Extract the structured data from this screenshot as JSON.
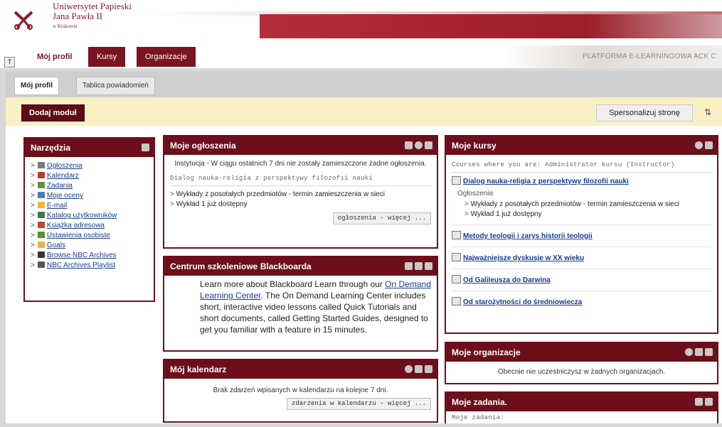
{
  "header": {
    "university_lines": [
      "Uniwersytet Papieski",
      "Jana Pawła II",
      "w Krakowie"
    ],
    "platform_text": "PLATFORMA E-LEARNINGOWA ACK C",
    "colors": {
      "maroon": "#6d0f1b",
      "accent_red": "#a8232f",
      "banner_yellow": "#fbefc4"
    }
  },
  "tabs": [
    {
      "label": "Mój profil"
    },
    {
      "label": "Kursy"
    },
    {
      "label": "Organizacje"
    }
  ],
  "subtabs": [
    {
      "label": "Mój profil"
    },
    {
      "label": "Tablica powiadomień"
    }
  ],
  "toolbar": {
    "add_module": "Dodaj moduł",
    "personalize": "Spersonalizuj stronę",
    "sort_icon": "⇅"
  },
  "tools_module": {
    "title": "Narzędzia",
    "items": [
      {
        "label": "Ogłoszenia",
        "icon": "megaphone-icon",
        "color": "#7a7a7a"
      },
      {
        "label": "Kalendarz",
        "icon": "calendar-icon",
        "color": "#c0392b"
      },
      {
        "label": "Zadania",
        "icon": "tasks-icon",
        "color": "#6a8e3a"
      },
      {
        "label": "Moje oceny",
        "icon": "grades-icon",
        "color": "#4d7fb8"
      },
      {
        "label": "E-mail",
        "icon": "envelope-icon",
        "color": "#e5b93a"
      },
      {
        "label": "Katalog użytkowników",
        "icon": "users-catalog-icon",
        "color": "#3c7a4a"
      },
      {
        "label": "Książka adresowa",
        "icon": "address-book-icon",
        "color": "#b04a3a"
      },
      {
        "label": "Ustawienia osobiste",
        "icon": "settings-icon",
        "color": "#5a8f2c"
      },
      {
        "label": "Goals",
        "icon": "folder-icon",
        "color": "#e0b64c"
      },
      {
        "label": "Browse NBC Archives",
        "icon": "archive-icon",
        "color": "#333333"
      },
      {
        "label": "NBC Archives Playlist",
        "icon": "playlist-icon",
        "color": "#555555"
      }
    ]
  },
  "announcements_module": {
    "title": "Moje ogłoszenia",
    "institution_note": "Instytucja - W ciągu ostatnich 7 dni nie zostały zamieszczone żadne ogłoszenia.",
    "course_heading": "Dialog nauka-religia z perspektywy filozofii nauki",
    "items": [
      "Wykłady z posotałych przedmiotów - termin zamieszczenia w sieci",
      "Wykład 1 już dostępny"
    ],
    "more": "ogłoszenia - więcej ..."
  },
  "blackboard_module": {
    "title": "Centrum szkoleniowe Blackboarda",
    "text_before": "Learn more about Blackboard Learn through our ",
    "link": "On Demand Learning Center",
    "text_after": ". The On Demand Learning Center includes short, interactive video lessons called Quick Tutorials and short documents, called Getting Started Guides, designed to get you familiar with a feature in 15 minutes."
  },
  "calendar_module": {
    "title": "Mój kalendarz",
    "note": "Brak zdarzeń wpisanych w kalendarzu na kolejne 7 dni.",
    "more": "zdarzenia w kalendarzu - więcej ..."
  },
  "courses_module": {
    "title": "Moje kursy",
    "role_heading": "Courses where you are: Administrator kursu (Instructor)",
    "first_course": "Dialog nauka-religia z perspektywy filozofii nauki",
    "announcements_label": "Ogłoszenia",
    "announcements": [
      "Wykłady z posotałych przedmiotów - termin zamieszczenia w sieci",
      "Wykład 1 już dostępny"
    ],
    "other_courses": [
      "Metody teologii i zarys historii teologii",
      "Najważniejsze dyskusje w XX wieku",
      "Od Galileusza do Darwina",
      "Od starożytności do średniowiecza"
    ]
  },
  "organizations_module": {
    "title": "Moje organizacje",
    "note": "Obecnie nie uczestniczysz w żadnych organizacjach."
  },
  "tasks_module": {
    "title": "Moje zadania.",
    "sub": "Moje zadania:"
  }
}
